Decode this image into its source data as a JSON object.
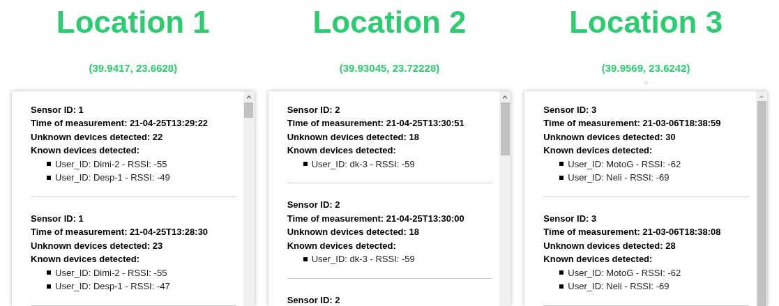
{
  "locations": [
    {
      "title": "Location 1",
      "coords": "(39.9417, 23.6628)",
      "entries": [
        {
          "sensor": "Sensor ID: 1",
          "time": "Time of measurement: 21-04-25T13:29:22",
          "unknown": "Unknown devices detected: 22",
          "known_label": "Known devices detected:",
          "devices": [
            "User_ID: Dimi-2 - RSSI: -55",
            "User_ID: Desp-1 - RSSI: -49"
          ]
        },
        {
          "sensor": "Sensor ID: 1",
          "time": "Time of measurement: 21-04-25T13:28:30",
          "unknown": "Unknown devices detected: 23",
          "known_label": "Known devices detected:",
          "devices": [
            "User_ID: Dimi-2 - RSSI: -55",
            "User_ID: Desp-1 - RSSI: -47"
          ]
        }
      ]
    },
    {
      "title": "Location 2",
      "coords": "(39.93045, 23.72228)",
      "entries": [
        {
          "sensor": "Sensor ID: 2",
          "time": "Time of measurement: 21-04-25T13:30:51",
          "unknown": "Unknown devices detected: 18",
          "known_label": "Known devices detected:",
          "devices": [
            "User_ID: dk-3 - RSSI: -59"
          ]
        },
        {
          "sensor": "Sensor ID: 2",
          "time": "Time of measurement: 21-04-25T13:30:00",
          "unknown": "Unknown devices detected: 18",
          "known_label": "Known devices detected:",
          "devices": [
            "User_ID: dk-3 - RSSI: -59"
          ]
        },
        {
          "sensor": "Sensor ID: 2"
        }
      ]
    },
    {
      "title": "Location 3",
      "coords": "(39.9569, 23.6242)",
      "entries": [
        {
          "sensor": "Sensor ID: 3",
          "time": "Time of measurement: 21-03-06T18:38:59",
          "unknown": "Unknown devices detected: 30",
          "known_label": "Known devices detected:",
          "devices": [
            "User_ID: MotoG - RSSI: -62",
            "User_ID: Neli - RSSI: -69"
          ]
        },
        {
          "sensor": "Sensor ID: 3",
          "time": "Time of measurement: 21-03-06T18:38:08",
          "unknown": "Unknown devices detected: 28",
          "known_label": "Known devices detected:",
          "devices": [
            "User_ID: MotoG - RSSI: -62",
            "User_ID: Neli - RSSI: -69"
          ]
        }
      ]
    }
  ]
}
